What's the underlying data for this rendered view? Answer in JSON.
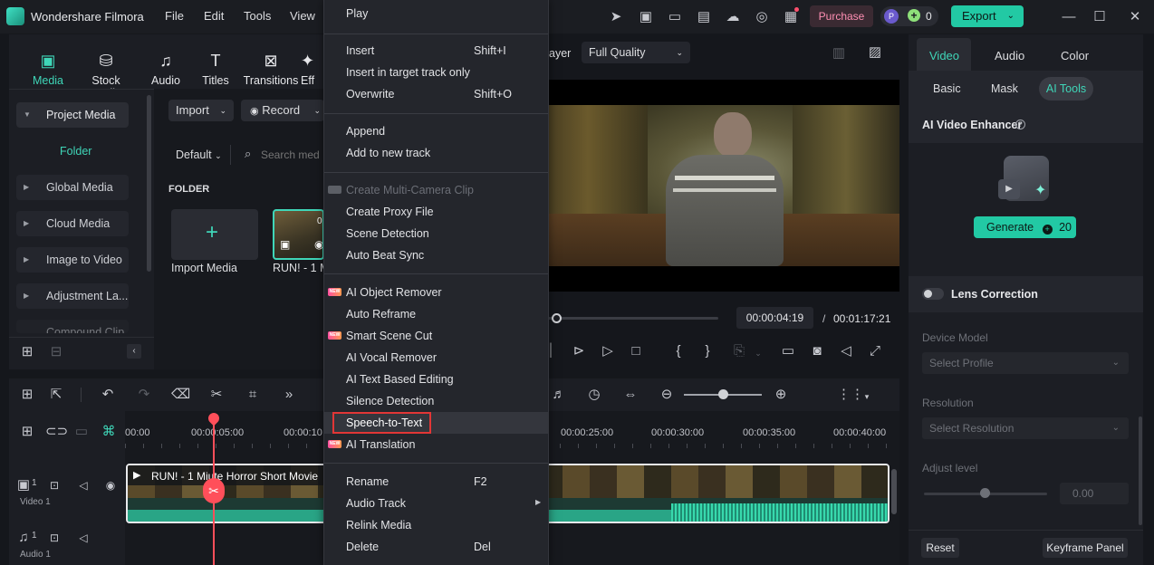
{
  "app": {
    "title": "Wondershare Filmora"
  },
  "menubar": {
    "file": "File",
    "edit": "Edit",
    "tools": "Tools",
    "view": "View"
  },
  "titlebar": {
    "purchase": "Purchase",
    "credits": "0",
    "export": "Export",
    "avatar": "P"
  },
  "toolbar": {
    "media": "Media",
    "stock_media": "Stock Media",
    "audio": "Audio",
    "titles": "Titles",
    "transitions": "Transitions",
    "effects": "Eff"
  },
  "sidebar": {
    "project_media": "Project Media",
    "folder": "Folder",
    "items": [
      "Global Media",
      "Cloud Media",
      "Image to Video",
      "Adjustment La...",
      "Compound Clip"
    ]
  },
  "media": {
    "import": "Import",
    "record": "Record",
    "sort": "Default",
    "search_placeholder": "Search med",
    "folder_heading": "FOLDER",
    "import_media": "Import Media",
    "clip_name": "RUN! - 1 M",
    "clip_badge": "0"
  },
  "player": {
    "mode": "ayer",
    "quality": "Full Quality",
    "current_time": "00:00:04:19",
    "separator": "/",
    "total_time": "00:01:17:21",
    "progress": 0.02
  },
  "context_menu": {
    "items": [
      {
        "label": "Play"
      },
      {
        "label": "Insert",
        "shortcut": "Shift+I"
      },
      {
        "label": "Insert in target track only"
      },
      {
        "label": "Overwrite",
        "shortcut": "Shift+O"
      },
      {
        "label": "Append"
      },
      {
        "label": "Add to new track"
      },
      {
        "label": "Create Multi-Camera Clip",
        "disabled": true
      },
      {
        "label": "Create Proxy File"
      },
      {
        "label": "Scene Detection"
      },
      {
        "label": "Auto Beat Sync"
      },
      {
        "label": "AI Object Remover",
        "badge": "NEW"
      },
      {
        "label": "Auto Reframe"
      },
      {
        "label": "Smart Scene Cut",
        "badge": "NEW"
      },
      {
        "label": "AI Vocal Remover"
      },
      {
        "label": "AI Text Based Editing"
      },
      {
        "label": "Silence Detection"
      },
      {
        "label": "Speech-to-Text",
        "highlighted": true
      },
      {
        "label": "AI Translation",
        "badge": "NEW"
      },
      {
        "label": "Rename",
        "shortcut": "F2"
      },
      {
        "label": "Audio Track",
        "submenu": true
      },
      {
        "label": "Relink Media"
      },
      {
        "label": "Delete",
        "shortcut": "Del"
      }
    ]
  },
  "right_panel": {
    "tabs": [
      "Video",
      "Audio",
      "Color"
    ],
    "subtabs": [
      "Basic",
      "Mask",
      "AI Tools"
    ],
    "enhancer_title": "AI Video Enhancer",
    "generate": "Generate",
    "generate_cost": "20",
    "lens_correction": "Lens Correction",
    "device_model": "Device Model",
    "select_profile": "Select Profile",
    "resolution": "Resolution",
    "select_resolution": "Select Resolution",
    "adjust_level": "Adjust level",
    "adjust_value": "0.00",
    "reset": "Reset",
    "keyframe_panel": "Keyframe Panel"
  },
  "timeline": {
    "ruler": [
      "00:00",
      "00:00:05:00",
      "00:00:10",
      "00:00:25:00",
      "00:00:30:00",
      "00:00:35:00",
      "00:00:40:00"
    ],
    "video_track": "Video 1",
    "audio_track": "Audio 1",
    "clip_title": "RUN! - 1 Mi",
    "clip_title_rest": "ute Horror Short Movie",
    "track_num": "1"
  },
  "colors": {
    "accent": "#22c9a4",
    "playhead": "#ff4f5a",
    "highlight_border": "#e23636"
  }
}
